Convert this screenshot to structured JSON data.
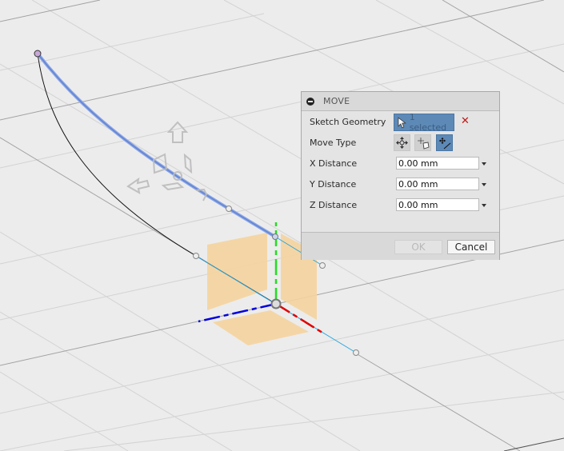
{
  "dialog": {
    "title": "MOVE",
    "collapse_icon": "minus-circle-icon",
    "sketch_geometry": {
      "label": "Sketch Geometry",
      "selection_label": "1 selected",
      "selection_icon": "cursor-arrow-icon",
      "clear_icon": "x-icon"
    },
    "move_type": {
      "label": "Move Type",
      "options": [
        {
          "name": "free-move",
          "icon": "move-arrows-icon",
          "active": false
        },
        {
          "name": "translate",
          "icon": "translate-box-icon",
          "active": false
        },
        {
          "name": "point-to-point",
          "icon": "point-to-point-icon",
          "active": true
        }
      ]
    },
    "fields": [
      {
        "label": "X Distance",
        "value": "0.00 mm"
      },
      {
        "label": "Y Distance",
        "value": "0.00 mm"
      },
      {
        "label": "Z Distance",
        "value": "0.00 mm"
      }
    ],
    "ok_label": "OK",
    "ok_enabled": false,
    "cancel_label": "Cancel"
  },
  "viewport": {
    "background": "#ececec",
    "colors": {
      "selected_curve": "#6e8fd4",
      "curve": "#111111",
      "construction_line": "#2aa7e0",
      "axis_x": "#e00000",
      "axis_y": "#22dd22",
      "axis_z": "#0000e0",
      "plane_handle": "#f5d49e"
    }
  }
}
